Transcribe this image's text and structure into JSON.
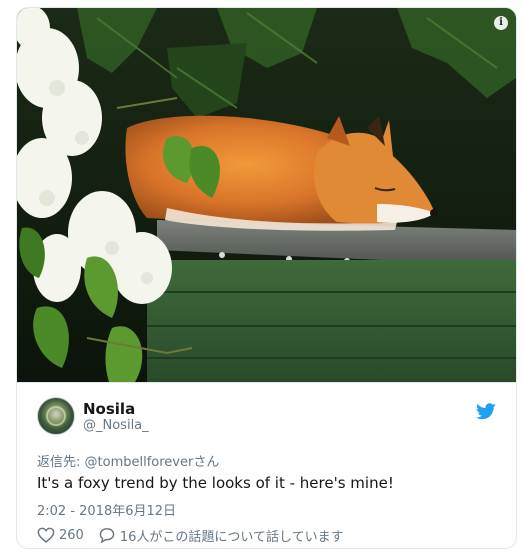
{
  "tweet": {
    "display_name": "Nosila",
    "handle": "@_Nosila_",
    "reply_prefix": "返信先: ",
    "reply_mention": "@tombellforeverさん",
    "text": "It's a foxy trend by the looks of it - here's mine!",
    "timestamp": "2:02 - 2018年6月12日",
    "like_count": "260",
    "reply_count_text": "16人がこの話題について話しています",
    "brand_color": "#1da1f2"
  },
  "media": {
    "info_icon": "info-icon",
    "info_glyph": "i",
    "subject": "fox sleeping on a fence beside white lilac blossoms"
  },
  "icons": {
    "twitter": "twitter-bird-icon",
    "like": "heart-icon",
    "reply": "speech-bubble-icon"
  }
}
